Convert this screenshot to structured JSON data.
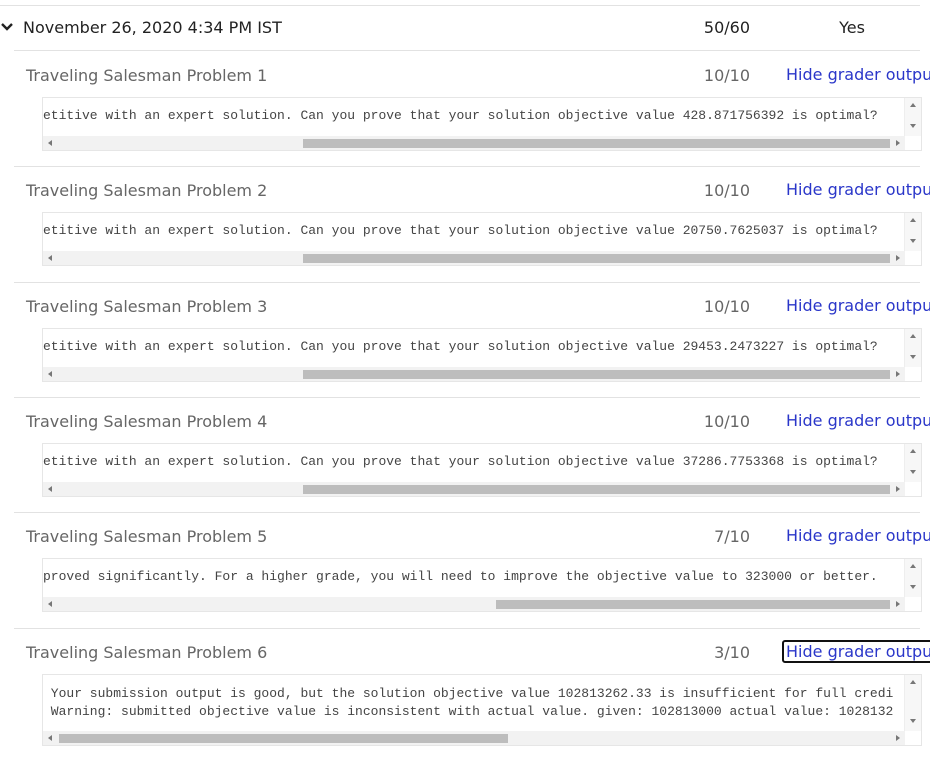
{
  "submission": {
    "date": "November 26, 2020 4:34 PM IST",
    "score": "50/60",
    "passed": "Yes"
  },
  "hide_label": "Hide grader output",
  "parts": [
    {
      "title": "Traveling Salesman Problem 1",
      "score": "10/10",
      "output": "etitive with an expert solution. Can you prove that your solution objective value 428.871756392 is optimal?"
    },
    {
      "title": "Traveling Salesman Problem 2",
      "score": "10/10",
      "output": "etitive with an expert solution. Can you prove that your solution objective value 20750.7625037 is optimal?"
    },
    {
      "title": "Traveling Salesman Problem 3",
      "score": "10/10",
      "output": "etitive with an expert solution. Can you prove that your solution objective value 29453.2473227 is optimal?"
    },
    {
      "title": "Traveling Salesman Problem 4",
      "score": "10/10",
      "output": "etitive with an expert solution. Can you prove that your solution objective value 37286.7753368 is optimal?"
    },
    {
      "title": "Traveling Salesman Problem 5",
      "score": "7/10",
      "output": "proved significantly. For a higher grade, you will need to improve the objective value to 323000 or better."
    },
    {
      "title": "Traveling Salesman Problem 6",
      "score": "3/10",
      "output": " Your submission output is good, but the solution objective value 102813262.33 is insufficient for full credi\n Warning: submitted objective value is inconsistent with actual value. given: 102813000 actual value: 1028132"
    }
  ]
}
